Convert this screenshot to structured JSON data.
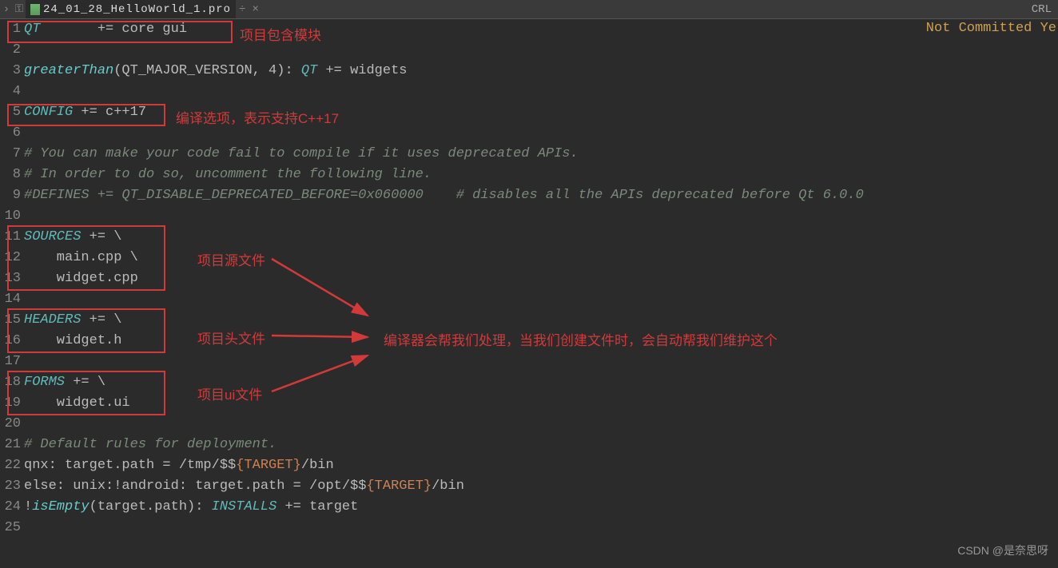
{
  "tab": {
    "filename": "24_01_28_HelloWorld_1.pro",
    "crl": "CRL",
    "nav": "›",
    "lock": "⚿",
    "dropdown": "÷",
    "close": "×"
  },
  "status": {
    "not_committed": "Not Committed Ye"
  },
  "gutter": [
    "1",
    "2",
    "3",
    "4",
    "5",
    "6",
    "7",
    "8",
    "9",
    "10",
    "11",
    "12",
    "13",
    "14",
    "15",
    "16",
    "17",
    "18",
    "19",
    "20",
    "21",
    "22",
    "23",
    "24",
    "25"
  ],
  "code": {
    "l1_qt": "QT",
    "l1_rest": "       += core gui",
    "l3_fn": "greaterThan",
    "l3_arg": "(QT_MAJOR_VERSION, 4): ",
    "l3_qt": "QT",
    "l3_rest": " += widgets",
    "l5_cfg": "CONFIG",
    "l5_rest": " += c++17",
    "l7": "# You can make your code fail to compile if it uses deprecated APIs.",
    "l8": "# In order to do so, uncomment the following line.",
    "l9": "#DEFINES += QT_DISABLE_DEPRECATED_BEFORE=0x060000    # disables all the APIs deprecated before Qt 6.0.0",
    "l11_kw": "SOURCES",
    "l11_rest": " += \\",
    "l12": "    main.cpp \\",
    "l13": "    widget.cpp",
    "l15_kw": "HEADERS",
    "l15_rest": " += \\",
    "l16": "    widget.h",
    "l18_kw": "FORMS",
    "l18_rest": " += \\",
    "l19": "    widget.ui",
    "l21": "# Default rules for deployment.",
    "l22a": "qnx: target.path = /tmp/$$",
    "l22b": "{TARGET}",
    "l22c": "/bin",
    "l23a": "else: unix:!android: target.path = /opt/$$",
    "l23b": "{TARGET}",
    "l23c": "/bin",
    "l24a": "!",
    "l24b": "isEmpty",
    "l24c": "(target.path): ",
    "l24d": "INSTALLS",
    "l24e": " += target"
  },
  "annotations": {
    "modules": "项目包含模块",
    "config": "编译选项，表示支持C++17",
    "sources": "项目源文件",
    "headers": "项目头文件",
    "forms": "项目ui文件",
    "main": "编译器会帮我们处理，当我们创建文件时，会自动帮我们维护这个"
  },
  "watermark": "CSDN @是奈思呀"
}
